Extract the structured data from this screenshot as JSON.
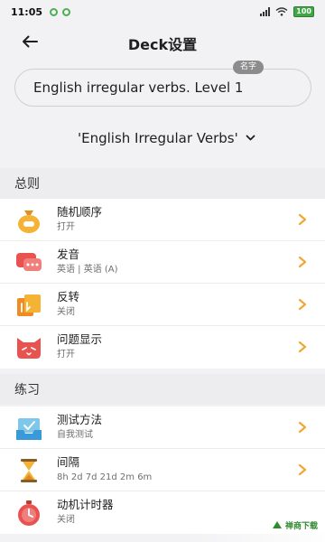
{
  "status_bar": {
    "time": "11:05",
    "battery": "100"
  },
  "header": {
    "title": "Deck设置"
  },
  "deck_name": {
    "badge": "名字",
    "value": "English irregular verbs. Level 1"
  },
  "deck_select": {
    "value": "'English Irregular Verbs'"
  },
  "sections": {
    "general": {
      "title": "总则",
      "items": [
        {
          "title": "随机顺序",
          "subtitle": "打开"
        },
        {
          "title": "发音",
          "subtitle": "英语 | 英语 (A)"
        },
        {
          "title": "反转",
          "subtitle": "关闭"
        },
        {
          "title": "问题显示",
          "subtitle": "打开"
        }
      ]
    },
    "practice": {
      "title": "练习",
      "items": [
        {
          "title": "测试方法",
          "subtitle": "自我测试"
        },
        {
          "title": "间隔",
          "subtitle": "8h  2d  7d  21d  2m  6m"
        },
        {
          "title": "动机计时器",
          "subtitle": "关闭"
        }
      ]
    }
  },
  "watermark": {
    "text": "禅商下载"
  },
  "colors": {
    "accent": "#f0a830",
    "background": "#f2f2f4",
    "card": "#ffffff"
  }
}
